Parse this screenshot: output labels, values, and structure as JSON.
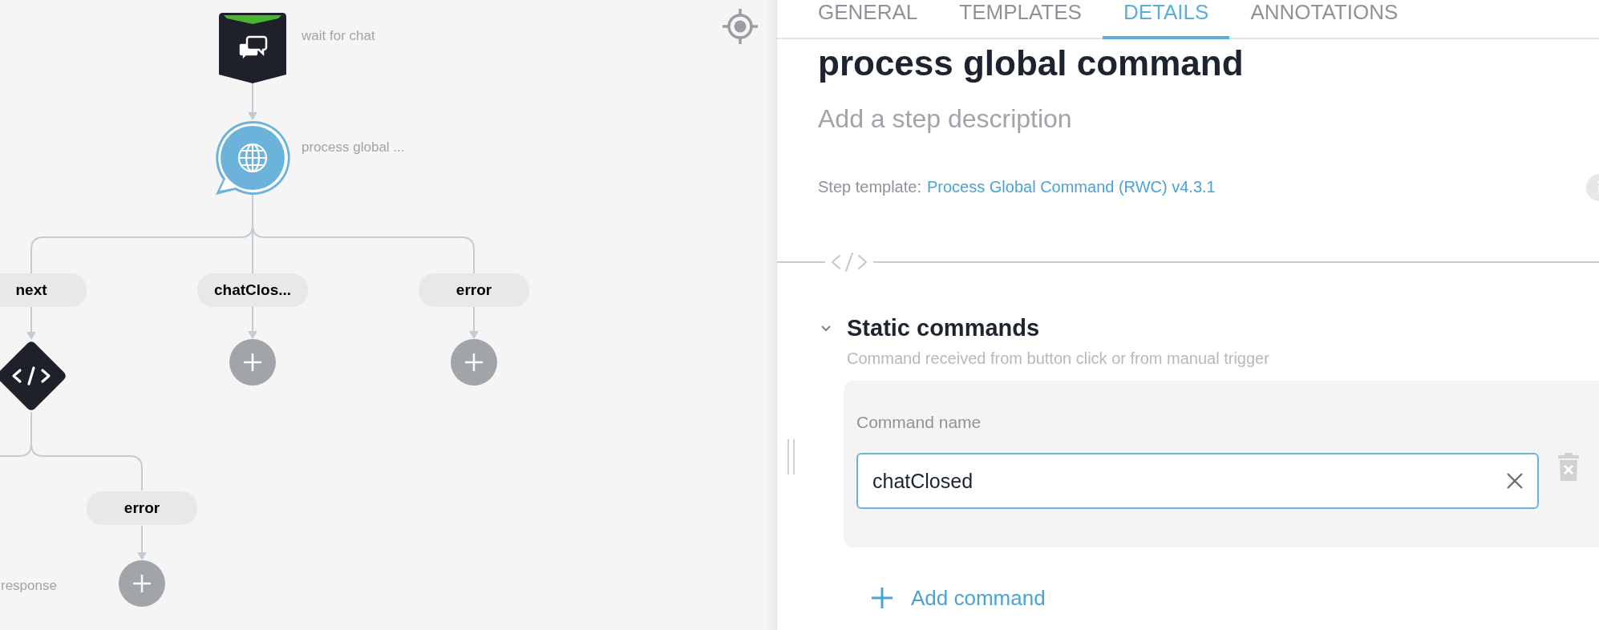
{
  "canvas": {
    "nodes": [
      {
        "kind": "chat",
        "label": "wait for chat"
      },
      {
        "kind": "globe",
        "label": "process global ..."
      }
    ],
    "branches": [
      {
        "label": "next"
      },
      {
        "label": "chatClos..."
      },
      {
        "label": "error"
      }
    ],
    "sub_branches": [
      {
        "label": "error"
      }
    ],
    "partial_label": "response"
  },
  "panel": {
    "tabs": [
      {
        "label": "GENERAL",
        "selected": false
      },
      {
        "label": "TEMPLATES",
        "selected": false
      },
      {
        "label": "DETAILS",
        "selected": true
      },
      {
        "label": "ANNOTATIONS",
        "selected": false
      }
    ],
    "title": "process global command",
    "description": {
      "placeholder": "Add a step description"
    },
    "step_template": {
      "label": "Step template:",
      "link": "Process Global Command (RWC) v4.3.1"
    },
    "section": {
      "title": "Static commands",
      "subtitle": "Command received from button click or from manual trigger",
      "expanded": true,
      "commands": [
        {
          "field_label": "Command name",
          "value": "chatClosed"
        }
      ]
    },
    "add_button": "Add command"
  }
}
